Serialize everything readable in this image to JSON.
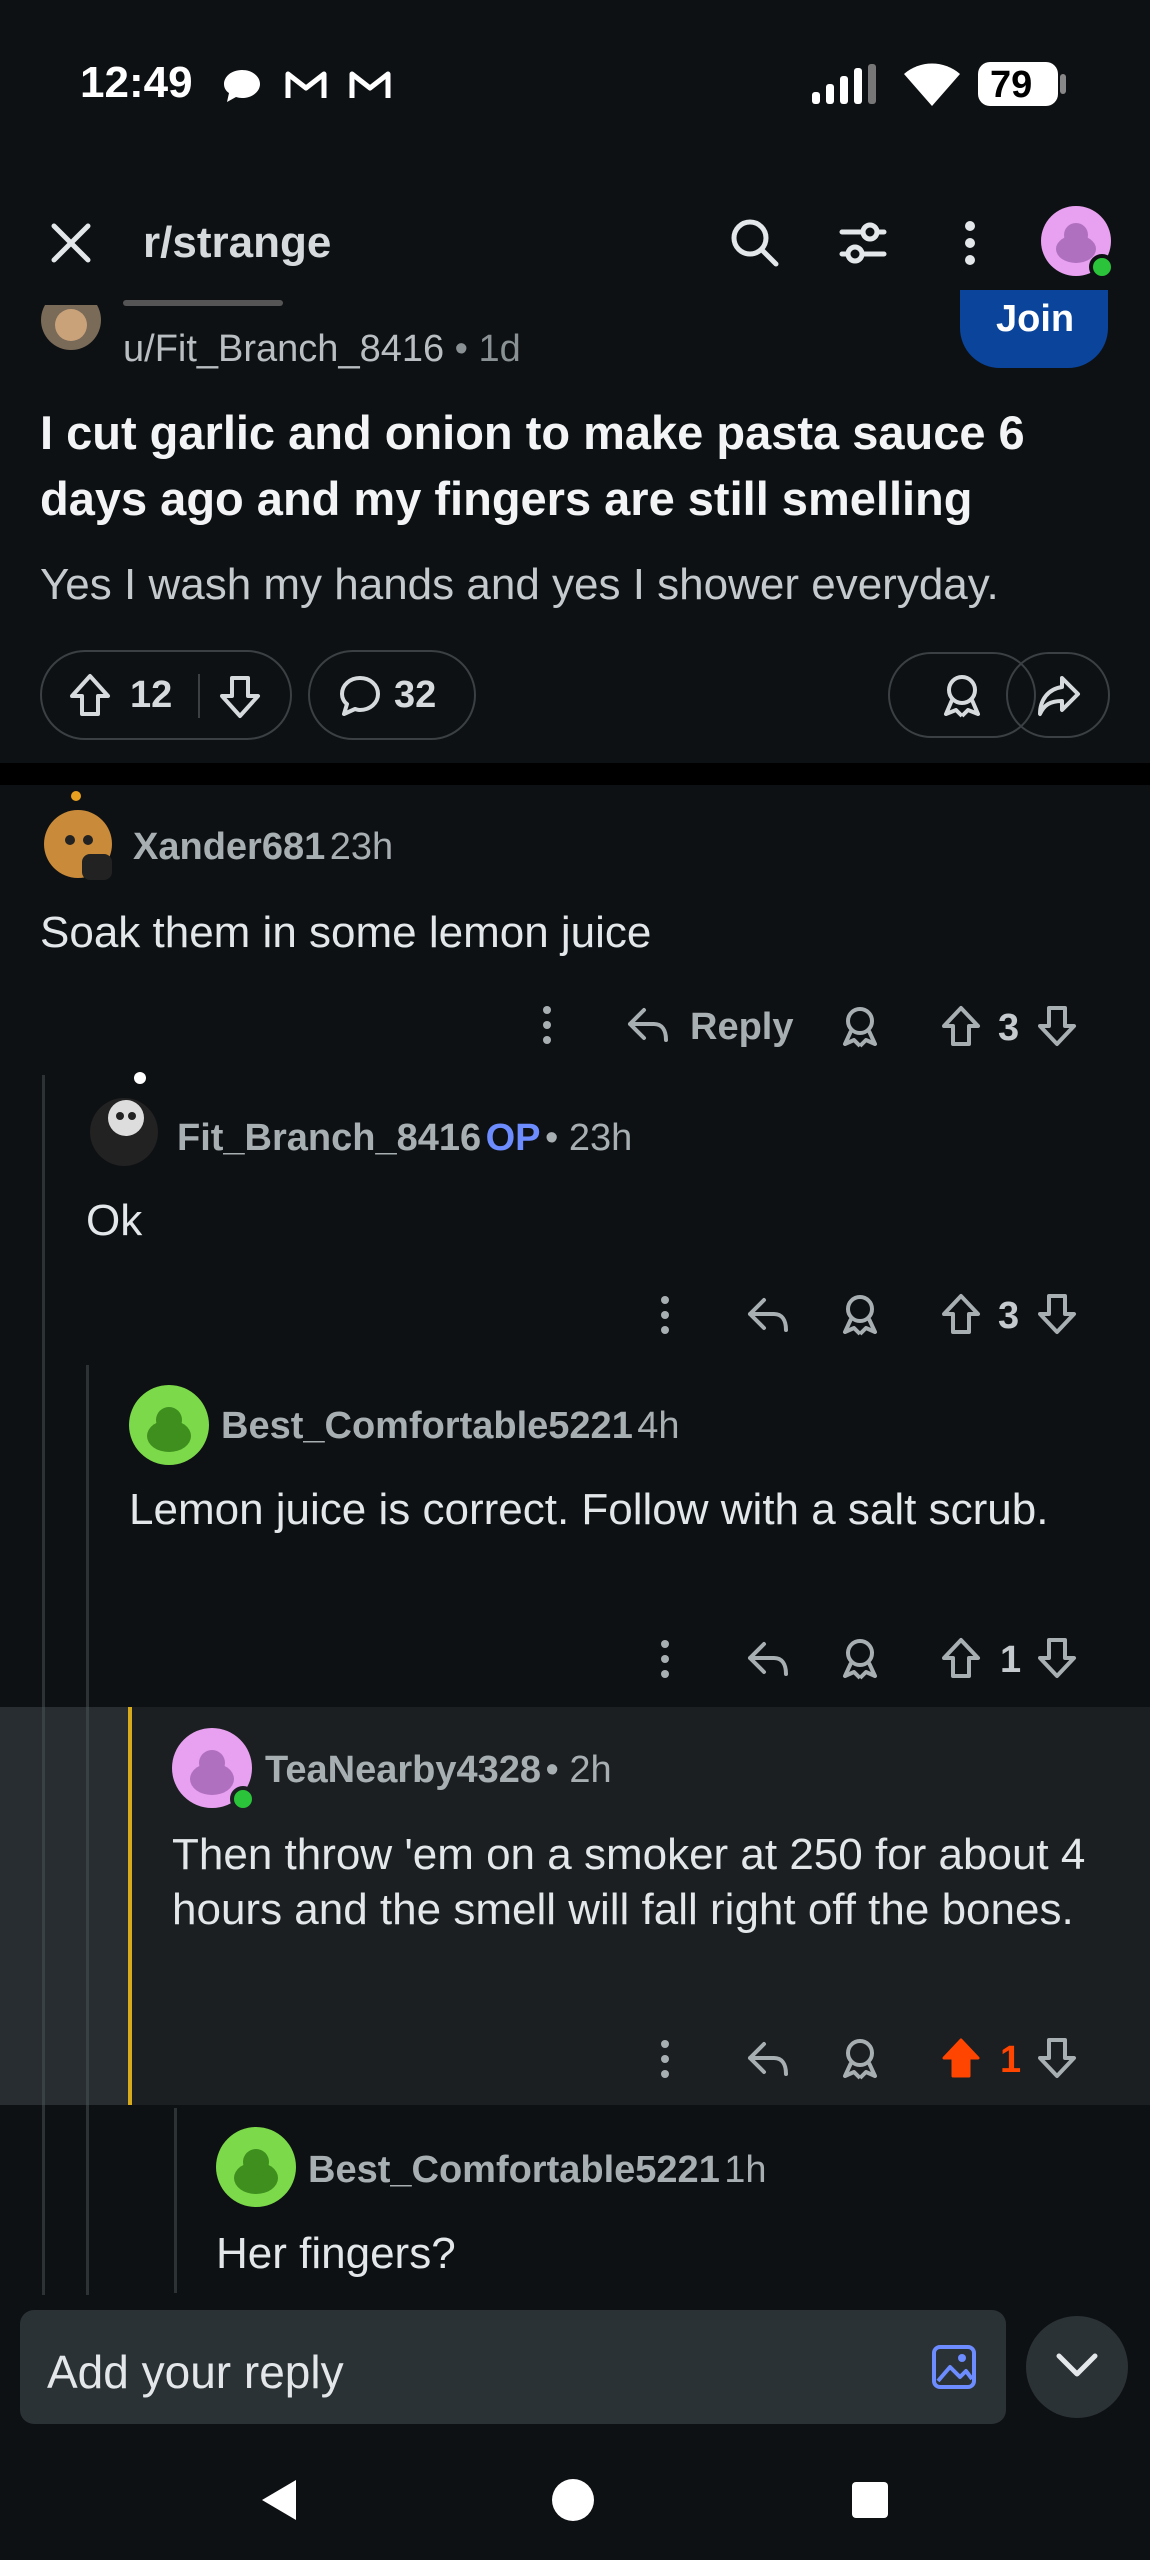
{
  "status": {
    "time": "12:49",
    "battery": "79"
  },
  "header": {
    "subreddit": "r/strange"
  },
  "post": {
    "author": "u/Fit_Branch_8416",
    "age": "• 1d",
    "join_label": "Join",
    "title": "I cut garlic and onion to make pasta sauce 6 days ago and my fingers are still smelling",
    "body": "Yes I wash my hands and yes I shower everyday.",
    "upvotes": "12",
    "comments": "32"
  },
  "comments": [
    {
      "user": "Xander681",
      "time": "23h",
      "text": "Soak them in some lemon juice",
      "score": "3",
      "reply_label": "Reply"
    },
    {
      "user": "Fit_Branch_8416",
      "op": "OP",
      "time": "• 23h",
      "text": "Ok",
      "score": "3"
    },
    {
      "user": "Best_Comfortable5221",
      "time": "4h",
      "text": "Lemon juice is correct. Follow with a salt scrub.",
      "score": "1"
    },
    {
      "user": "TeaNearby4328",
      "time": "• 2h",
      "text": "Then throw 'em on a smoker at 250 for about 4 hours and the smell will fall right off the bones.",
      "score": "1"
    },
    {
      "user": "Best_Comfortable5221",
      "time": "1h",
      "text": "Her fingers?"
    }
  ],
  "reply_box": {
    "placeholder": "Add your reply"
  },
  "colors": {
    "accent": "#0a449b",
    "upvoted": "#ff4500",
    "op": "#6c8cff",
    "highlight_bar": "#d7a91d"
  }
}
